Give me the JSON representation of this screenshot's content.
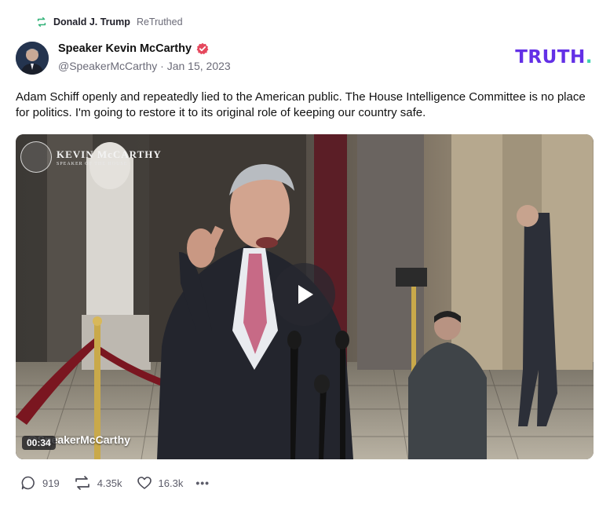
{
  "retruth": {
    "author": "Donald J. Trump",
    "label": "ReTruthed",
    "icon": "retruth-icon"
  },
  "post": {
    "display_name": "Speaker Kevin McCarthy",
    "handle": "@SpeakerMcCarthy",
    "separator": "·",
    "date": "Jan 15, 2023",
    "verified": true,
    "text": "Adam Schiff openly and repeatedly lied to the American public. The House Intelligence Committee is no place for politics. I'm going to restore it to its original role of keeping our country safe."
  },
  "brand": {
    "logo_text": "TRUTH",
    "logo_dot": ".",
    "primary_color": "#6330e6",
    "accent_color": "#3dd3b0"
  },
  "video": {
    "watermark_title": "KEVIN McCARTHY",
    "watermark_subtitle": "SPEAKER OF THE HOUSE",
    "caption": "@SpeakerMcCarthy",
    "time": "00:34",
    "play_icon": "play-icon"
  },
  "stats": {
    "replies": "919",
    "retruths": "4.35k",
    "likes": "16.3k",
    "more": "•••"
  },
  "icons": {
    "reply": "reply-icon",
    "retruth": "retruth-icon",
    "like": "heart-icon",
    "more": "more-icon",
    "verified": "verified-badge-icon"
  }
}
